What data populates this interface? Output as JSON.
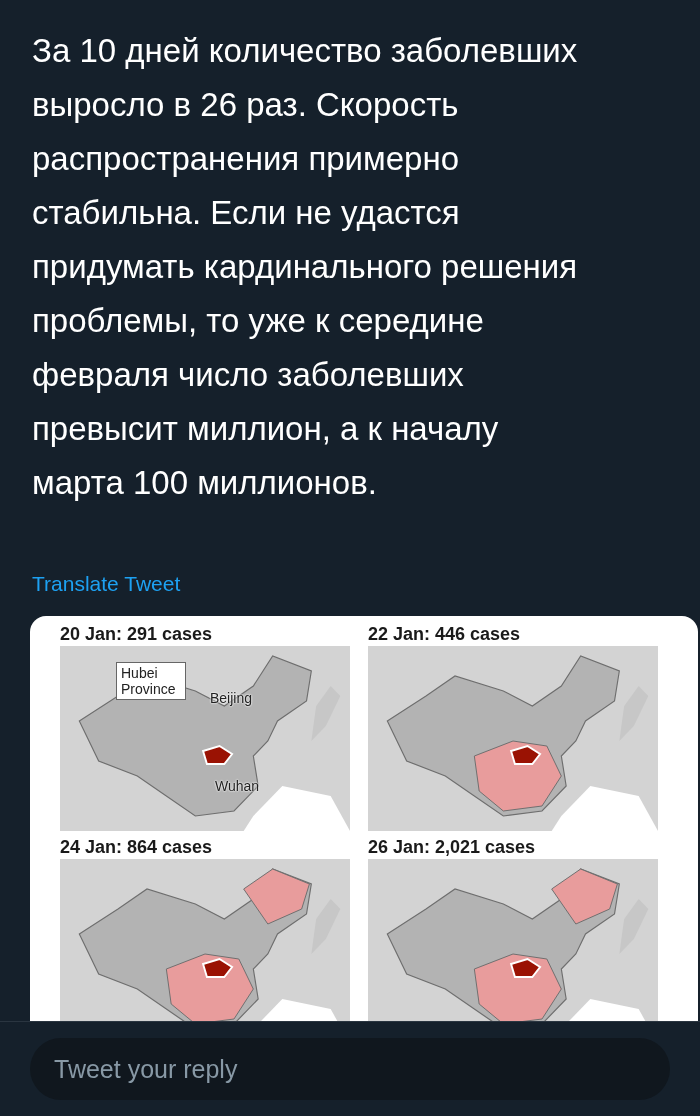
{
  "tweet": {
    "text": "За 10 дней количество заболевших выросло в 26 раз. Скорость распространения примерно стабильна. Если не удастся придумать кардинального решения проблемы, то уже к середине февраля число заболевших превысит миллион, а к началу марта 100 миллионов.",
    "translate_link": "Translate Tweet"
  },
  "media": {
    "panels": [
      {
        "title": "20 Jan: 291 cases",
        "callout": "Hubei Province",
        "city_labels": [
          "Beijing",
          "Wuhan"
        ]
      },
      {
        "title": "22 Jan: 446 cases"
      },
      {
        "title": "24 Jan: 864 cases"
      },
      {
        "title": "26 Jan: 2,021 cases"
      }
    ]
  },
  "reply": {
    "placeholder": "Tweet your reply"
  }
}
